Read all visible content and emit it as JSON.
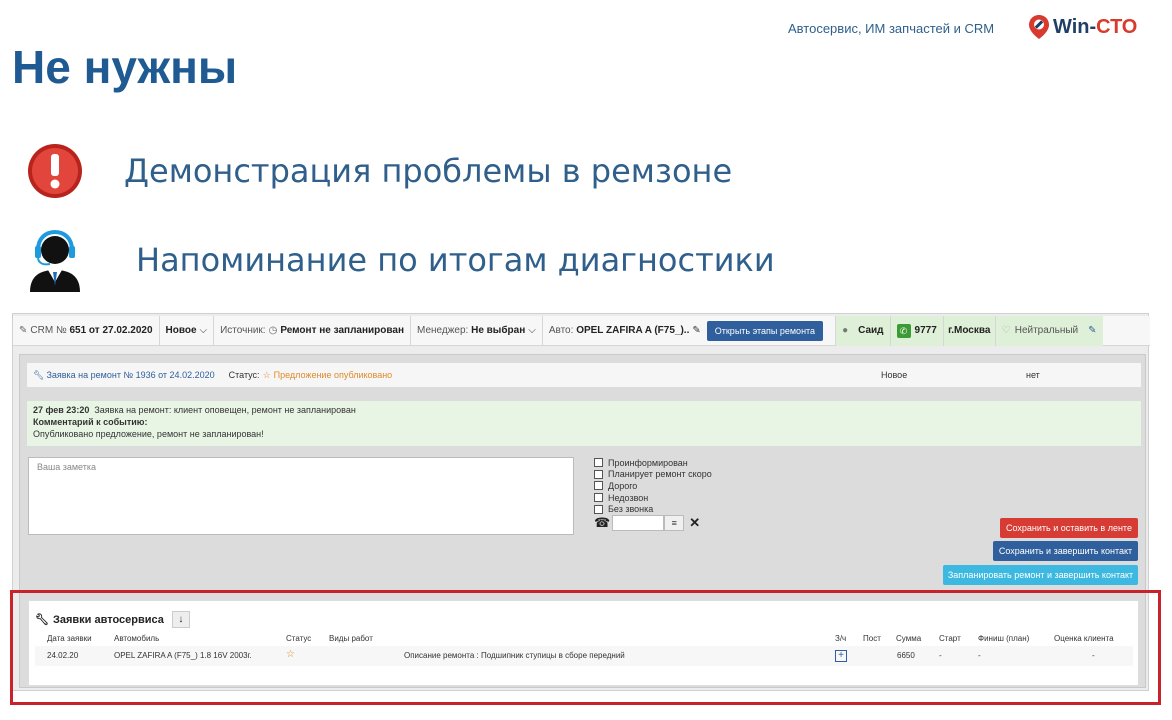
{
  "header": {
    "tagline": "Автосервис, ИМ запчастей и CRM",
    "logo_win": "Win-",
    "logo_cto": "СТО",
    "title": "Не нужны"
  },
  "bullets": [
    {
      "icon": "warning-icon",
      "text": "Демонстрация проблемы в ремзоне"
    },
    {
      "icon": "operator-headset-icon",
      "text": "Напоминание по итогам диагностики"
    }
  ],
  "crm_bar": {
    "crm_label": "CRM №",
    "crm_number": "651 от 27.02.2020",
    "state": "Новое",
    "source_label": "Источник:",
    "source_value": "Ремонт не запланирован",
    "manager_label": "Менеджер:",
    "manager_value": "Не выбран",
    "auto_label": "Авто:",
    "auto_value": "OPEL ZAFIRA A (F75_)..",
    "open_stages_button": "Открыть этапы ремонта",
    "client_name": "Саид",
    "phone": "9777",
    "city": "г.Москва",
    "mood": "Нейтральный"
  },
  "request": {
    "link": "Заявка на ремонт № 1936 от 24.02.2020",
    "status_label": "Статус:",
    "status_value": "Предложение опубликовано",
    "state": "Новое",
    "extra": "нет"
  },
  "event": {
    "time": "27 фев 23:20",
    "text": "Заявка на ремонт: клиент оповещен, ремонт не запланирован",
    "comment_label": "Комментарий к событию:",
    "comment": "Опубликовано предложение, ремонт не запланирован!"
  },
  "note": {
    "placeholder": "Ваша заметка"
  },
  "checkboxes": [
    "Проинформирован",
    "Планирует ремонт скоро",
    "Дорого",
    "Недозвон",
    "Без звонка"
  ],
  "buttons": {
    "save_keep": "Сохранить и оставить в ленте",
    "save_finish": "Сохранить и завершить контакт",
    "plan_finish": "Запланировать ремонт и завершить контакт"
  },
  "orders": {
    "title": "Заявки автосервиса",
    "columns": [
      "Дата заявки",
      "Автомобиль",
      "Статус",
      "Виды работ",
      "З/ч",
      "Пост",
      "Сумма",
      "Старт",
      "Финиш (план)",
      "Оценка клиента"
    ],
    "rows": [
      {
        "date": "24.02.20",
        "car": "OPEL ZAFIRA A (F75_) 1.8 16V 2003г.",
        "description": "Описание ремонта : Подшипник ступицы в сборе передний",
        "sum": "6650",
        "start": "-",
        "finish": "-",
        "rating": "-"
      }
    ]
  },
  "colors": {
    "title_blue": "#1f5a92",
    "text_blue": "#2f5f8a",
    "brand_red": "#d83a2e",
    "highlight_red": "#c8232b"
  }
}
